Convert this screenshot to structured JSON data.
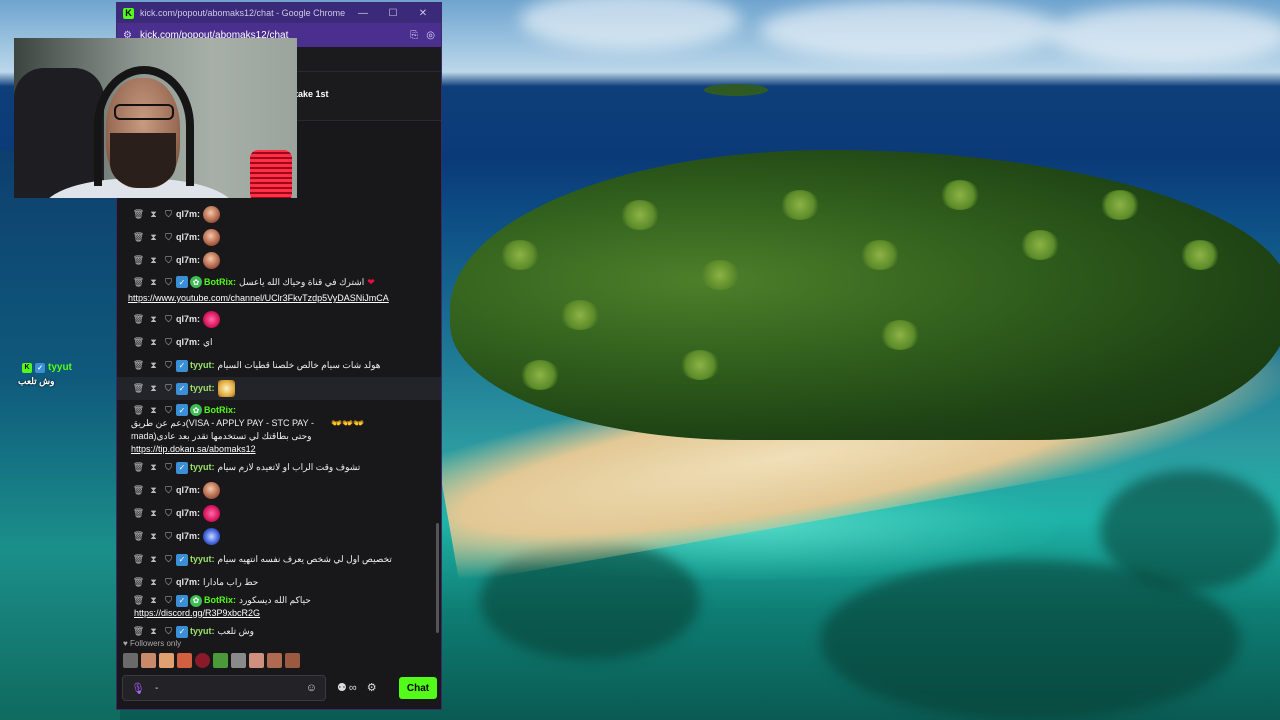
{
  "browser": {
    "title": "kick.com/popout/abomaks12/chat - Google Chrome",
    "url": "kick.com/popout/abomaks12/chat",
    "controls": [
      "—",
      "☐",
      "✕"
    ]
  },
  "pinned": {
    "text": "o take 1st"
  },
  "overlay": {
    "username": "tyyut",
    "message": "وش تلعب"
  },
  "messages": [
    {
      "user": "ql7m:",
      "emote": "face"
    },
    {
      "user": "ql7m:",
      "emote": "face"
    },
    {
      "user": "ql7m:",
      "emote": "face"
    },
    {
      "user": "BotRix:",
      "text": "اشترك في قناة وحياك الله ياعسل",
      "link": "https://www.youtube.com/channel/UClr3FkvTzdp5VyDASNiJmCA"
    },
    {
      "user": "ql7m:",
      "emote": "pink"
    },
    {
      "user": "ql7m:",
      "text": "اي"
    },
    {
      "user": "tyyut:",
      "text": "هولد شات سيام خالص خلصنا قطيات السيام"
    },
    {
      "user": "tyyut:",
      "emote": "cat"
    },
    {
      "user": "BotRix:",
      "text": "دعم عن طريق(VISA - APPLY PAY - STC PAY - mada)وحتى بطاقتك لي تستخدمها تقدر بعد عادي",
      "link": "https://tip.dokan.sa/abomaks12"
    },
    {
      "user": "tyyut:",
      "text": "تشوف وقت الراب او لاتعيده لازم سيام"
    },
    {
      "user": "ql7m:",
      "emote": "face"
    },
    {
      "user": "ql7m:",
      "emote": "pink"
    },
    {
      "user": "ql7m:",
      "emote": "blue"
    },
    {
      "user": "tyyut:",
      "text": "تخصيص اول لي شخص يعرف نفسه انتهيه سيام"
    },
    {
      "user": "ql7m:",
      "text": "حط راب مادارا"
    },
    {
      "user": "BotRix:",
      "text": "حياكم الله ديسكورد",
      "link": "https://discord.gg/R3P9xbcR2G"
    },
    {
      "user": "tyyut:",
      "text": "وش تلعب"
    }
  ],
  "footer": {
    "followers_label": "Followers only",
    "input_value": "-",
    "send_label": "Chat",
    "count_icon": "∞"
  },
  "colors": {
    "brand": "#53fc18",
    "title_bar": "#3b2a79",
    "chat_bg": "#18181b"
  }
}
